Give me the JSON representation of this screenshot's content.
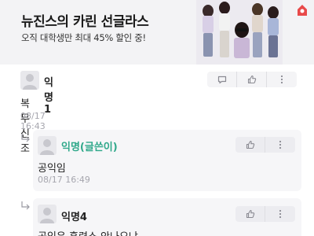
{
  "ad": {
    "title": "뉴진스의 카린 선글라스",
    "subtitle": "오직 대학생만 최대 45% 할인 중!"
  },
  "comments": [
    {
      "author": "익명1",
      "body": "복무신조",
      "time": "08/17 16:43",
      "actions": [
        "comment-icon",
        "thumbs-up-icon",
        "more-icon"
      ]
    }
  ],
  "replies": [
    {
      "author": "익명(글쓴이)",
      "is_op": true,
      "body": "공익임",
      "time": "08/17 16:49",
      "actions": [
        "thumbs-up-icon",
        "more-icon"
      ]
    },
    {
      "author": "익명4",
      "is_op": false,
      "body": "공익은 훈련소 안나오냐",
      "actions": [
        "thumbs-up-icon",
        "more-icon"
      ]
    }
  ],
  "colors": {
    "op_author": "#2fa88a",
    "time": "#a6a6ae",
    "reply_bg": "#f6f6f8",
    "ad_bg": "#f3f3f5",
    "logo": "#e84a4a"
  }
}
